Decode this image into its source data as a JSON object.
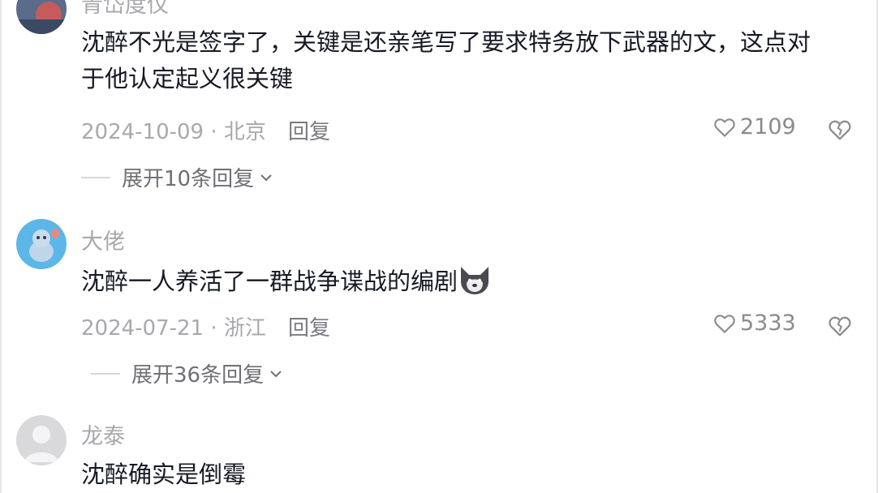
{
  "comments": [
    {
      "username": "青岱度仪",
      "content": "沈醉不光是签字了，关键是还亲笔写了要求特务放下武器的文，这点对于他认定起义很关键",
      "date_location": "2024-10-09 · 北京",
      "reply_label": "回复",
      "likes": "2109",
      "expand_label": "展开10条回复"
    },
    {
      "username": "大佬",
      "content": "沈醉一人养活了一群战争谍战的编剧",
      "emoji": "wolf-emoji",
      "date_location": "2024-07-21 · 浙江",
      "reply_label": "回复",
      "likes": "5333",
      "expand_label": "展开36条回复"
    },
    {
      "username": "龙泰",
      "content": "沈醉确实是倒霉"
    }
  ],
  "icons": {
    "like": "heart-outline-icon",
    "dislike": "broken-heart-icon",
    "expand": "chevron-down-icon"
  },
  "colors": {
    "text_primary": "#161823",
    "text_secondary": "#a8a8ad",
    "icon_gray": "#8a8a8f"
  }
}
